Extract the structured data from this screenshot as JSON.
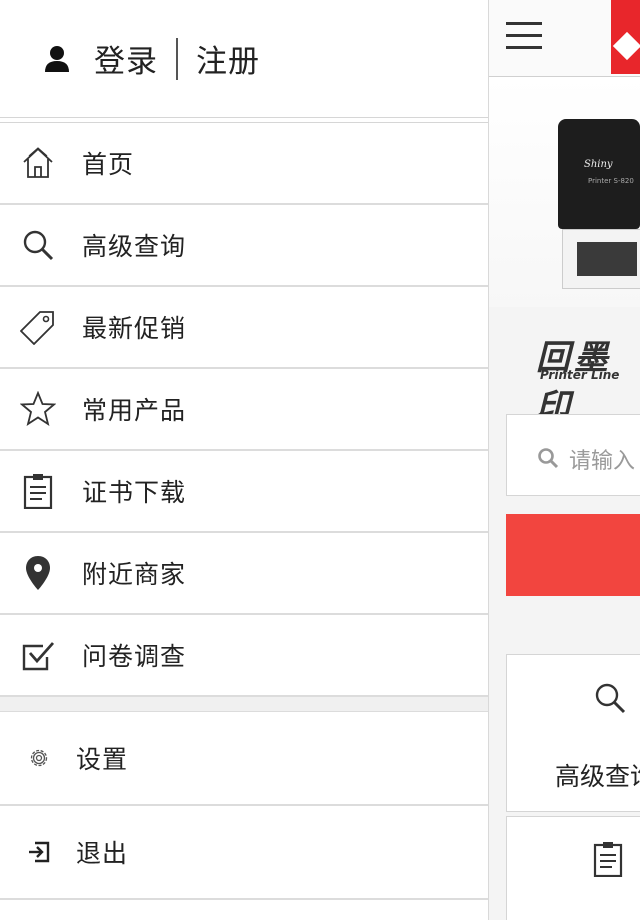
{
  "auth": {
    "login": "登录",
    "register": "注册"
  },
  "menu": [
    {
      "label": "首页",
      "icon": "home-icon"
    },
    {
      "label": "高级查询",
      "icon": "search-icon"
    },
    {
      "label": "最新促销",
      "icon": "tag-icon"
    },
    {
      "label": "常用产品",
      "icon": "star-icon"
    },
    {
      "label": "证书下载",
      "icon": "clipboard-icon"
    },
    {
      "label": "附近商家",
      "icon": "location-pin-icon"
    },
    {
      "label": "问卷调查",
      "icon": "checkbox-icon"
    }
  ],
  "menu2": [
    {
      "label": "设置",
      "icon": "gear-icon"
    },
    {
      "label": "退出",
      "icon": "logout-icon"
    }
  ],
  "page": {
    "logo_cn": "回墨印",
    "logo_en": "Printer Line",
    "stamp_brand": "Shiny",
    "stamp_model": "Printer S-820",
    "search_placeholder": "请输入",
    "card1_label": "高级查询"
  },
  "colors": {
    "brand_red": "#e8262b",
    "button_red": "#f2453f"
  }
}
